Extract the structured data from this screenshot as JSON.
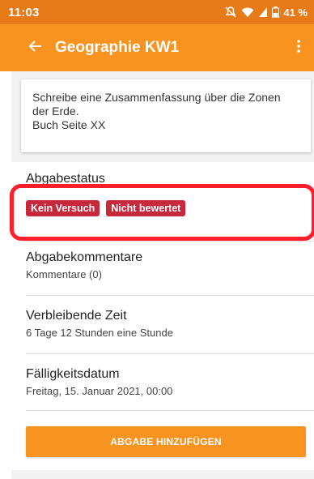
{
  "status_bar": {
    "time": "11:03",
    "battery": "41 %",
    "icons": [
      "mute-icon",
      "wifi-icon",
      "signal-icon",
      "battery-icon"
    ]
  },
  "app_bar": {
    "title": "Geographie KW1",
    "back_icon": "back-arrow-icon",
    "menu_icon": "more-vert-icon"
  },
  "assignment": {
    "description": "Schreibe eine Zusammenfassung über die Zonen\nder Erde.\nBuch Seite XX"
  },
  "submission_status": {
    "label": "Abgabestatus",
    "badges": [
      "Kein Versuch",
      "Nicht bewertet"
    ]
  },
  "comments": {
    "label": "Abgabekommentare",
    "value": "Kommentare (0)"
  },
  "remaining_time": {
    "label": "Verbleibende Zeit",
    "value": "6 Tage 12 Stunden eine Stunde"
  },
  "due_date": {
    "label": "Fälligkeitsdatum",
    "value": "Freitag, 15. Januar 2021, 00:00"
  },
  "actions": {
    "add_submission": "ABGABE HINZUFÜGEN"
  },
  "colors": {
    "status_bar": "#e67a16",
    "app_bar": "#f7931e",
    "badge": "#c8283c",
    "highlight": "#ff1e2a"
  }
}
